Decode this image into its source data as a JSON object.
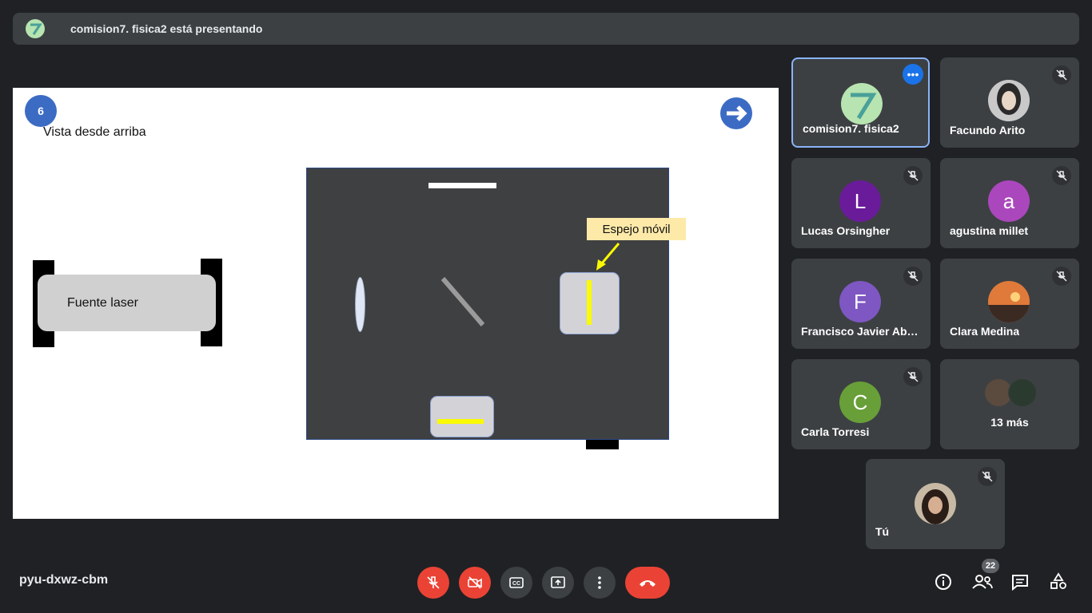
{
  "banner": {
    "text": "comision7. fisica2 está presentando"
  },
  "slide": {
    "number": "6",
    "caption": "Vista desde arriba",
    "laser_label": "Fuente  laser",
    "mirror_callout": "Espejo móvil"
  },
  "participants": [
    {
      "name": "comision7. fisica2",
      "avatar_type": "image",
      "active": true
    },
    {
      "name": "Facundo Arito",
      "avatar_type": "photo",
      "muted": true
    },
    {
      "name": "Lucas Orsingher",
      "initial": "L",
      "color": "#6a1b9a",
      "muted": true
    },
    {
      "name": "agustina millet",
      "initial": "a",
      "color": "#ab47bc",
      "muted": true
    },
    {
      "name": "Francisco Javier Abr…",
      "initial": "F",
      "color": "#7e57c2",
      "muted": true
    },
    {
      "name": "Clara Medina",
      "avatar_type": "photo",
      "muted": true
    },
    {
      "name": "Carla Torresi",
      "initial": "C",
      "color": "#689f38",
      "muted": true
    },
    {
      "name": "13 más",
      "avatar_type": "group"
    },
    {
      "name": "Tú",
      "avatar_type": "photo",
      "muted": true
    }
  ],
  "bottom": {
    "meeting_code": "pyu-dxwz-cbm",
    "people_count": "22"
  },
  "colors": {
    "danger": "#ea4335",
    "accent": "#1a73e8",
    "tile": "#3c4043"
  }
}
